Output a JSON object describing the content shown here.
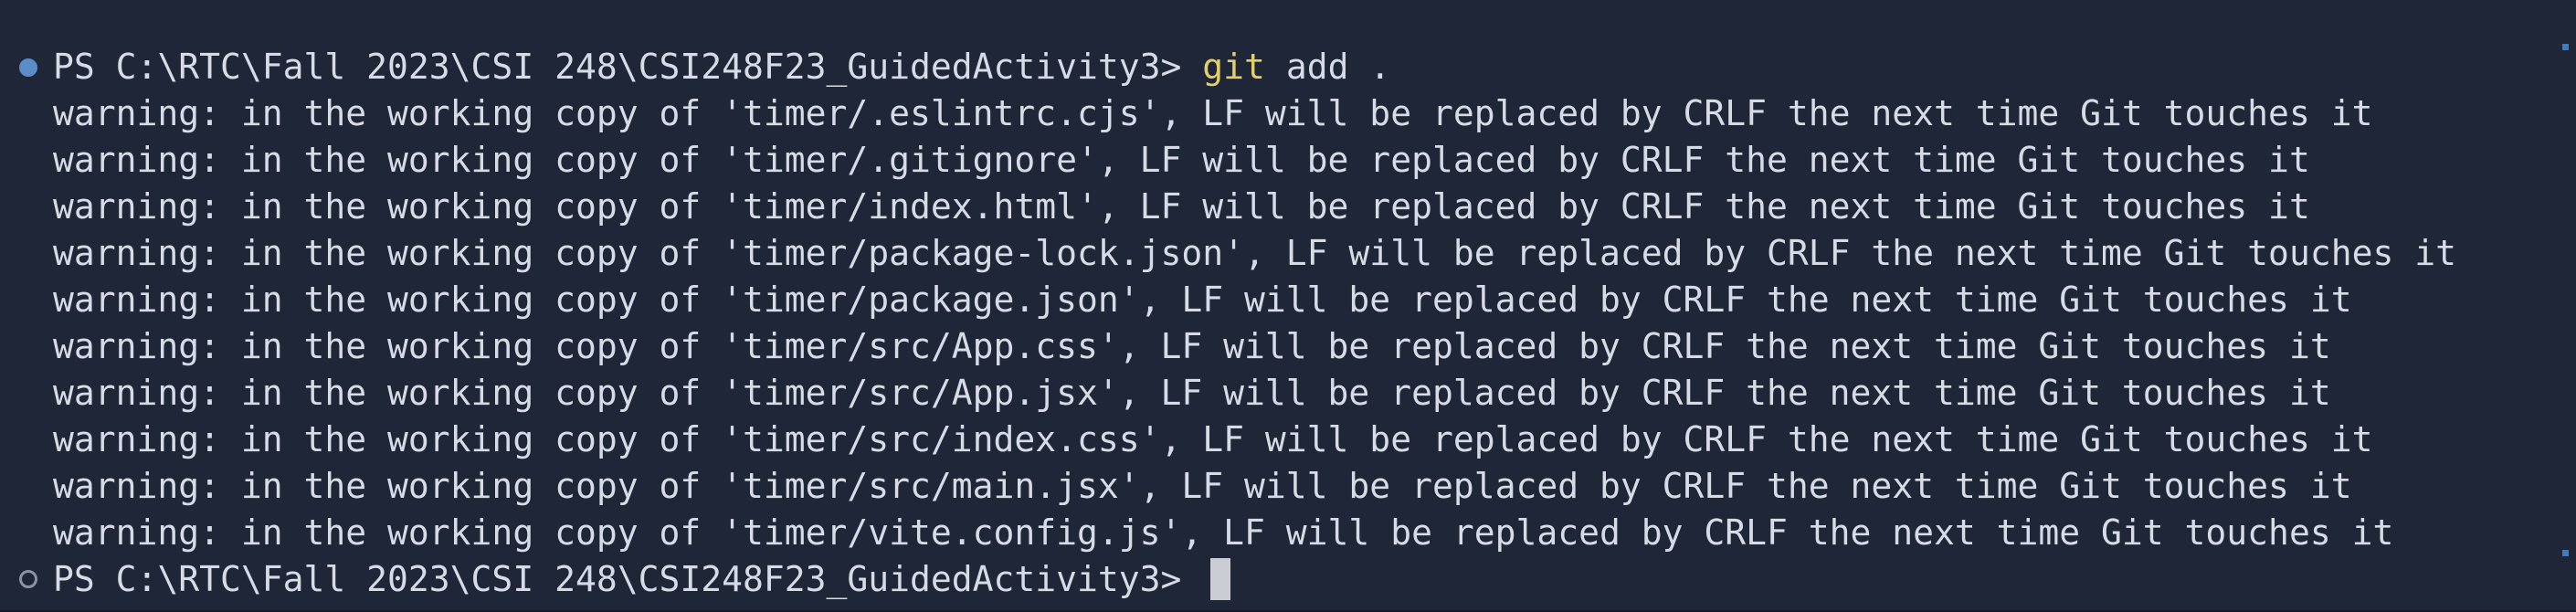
{
  "terminal": {
    "prompt": "PS C:\\RTC\\Fall 2023\\CSI 248\\CSI248F23_GuidedActivity3> ",
    "command_name": "git",
    "command_args": " add .",
    "warnings": [
      "warning: in the working copy of 'timer/.eslintrc.cjs', LF will be replaced by CRLF the next time Git touches it",
      "warning: in the working copy of 'timer/.gitignore', LF will be replaced by CRLF the next time Git touches it",
      "warning: in the working copy of 'timer/index.html', LF will be replaced by CRLF the next time Git touches it",
      "warning: in the working copy of 'timer/package-lock.json', LF will be replaced by CRLF the next time Git touches it",
      "warning: in the working copy of 'timer/package.json', LF will be replaced by CRLF the next time Git touches it",
      "warning: in the working copy of 'timer/src/App.css', LF will be replaced by CRLF the next time Git touches it",
      "warning: in the working copy of 'timer/src/App.jsx', LF will be replaced by CRLF the next time Git touches it",
      "warning: in the working copy of 'timer/src/index.css', LF will be replaced by CRLF the next time Git touches it",
      "warning: in the working copy of 'timer/src/main.jsx', LF will be replaced by CRLF the next time Git touches it",
      "warning: in the working copy of 'timer/vite.config.js', LF will be replaced by CRLF the next time Git touches it"
    ],
    "colors": {
      "background": "#1f2637",
      "foreground": "#d6dbe6",
      "command": "#e2cf6a",
      "decoration_success": "#5b8cc6",
      "decoration_pending": "#8a93a6",
      "scroll_marker": "#3e7bbf"
    }
  }
}
